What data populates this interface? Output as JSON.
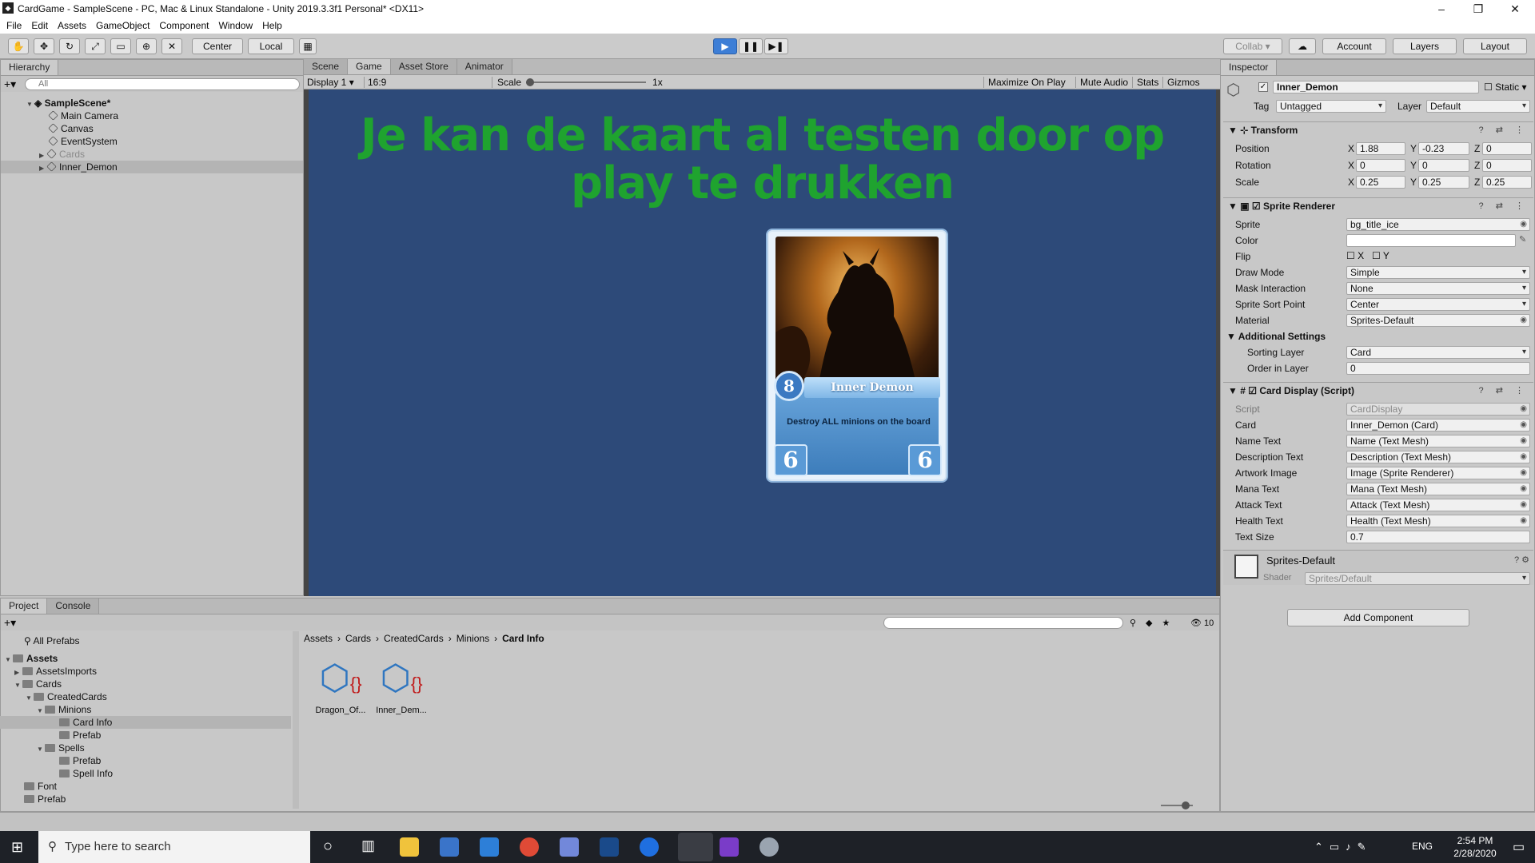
{
  "window": {
    "title": "CardGame - SampleScene - PC, Mac & Linux Standalone - Unity 2019.3.3f1 Personal* <DX11>",
    "min": "–",
    "max": "❐",
    "close": "✕"
  },
  "menu": [
    "File",
    "Edit",
    "Assets",
    "GameObject",
    "Component",
    "Window",
    "Help"
  ],
  "toolbar": {
    "center": "Center",
    "local": "Local",
    "collab": "Collab ▾",
    "account": "Account",
    "layers": "Layers",
    "layout": "Layout"
  },
  "hierarchy": {
    "tab": "Hierarchy",
    "search_placeholder": "All",
    "scene": "SampleScene*",
    "items": [
      "Main Camera",
      "Canvas",
      "EventSystem",
      "Cards",
      "Inner_Demon"
    ]
  },
  "game": {
    "tabs": [
      "Scene",
      "Game",
      "Asset Store",
      "Animator"
    ],
    "display": "Display 1",
    "aspect": "16:9",
    "scale_label": "Scale",
    "scale_value": "1x",
    "maximize": "Maximize On Play",
    "mute": "Mute Audio",
    "stats": "Stats",
    "gizmos": "Gizmos",
    "overlay_text": "Je kan de kaart al testen door op play te drukken",
    "overlay_color": "#1fa32f",
    "bg_color": "#2d4a79"
  },
  "card": {
    "mana": "8",
    "name": "Inner Demon",
    "description": "Destroy ALL minions on the board",
    "attack": "6",
    "health": "6"
  },
  "inspector": {
    "tab": "Inspector",
    "object_name": "Inner_Demon",
    "static": "Static",
    "tag_label": "Tag",
    "tag": "Untagged",
    "layer_label": "Layer",
    "layer": "Default",
    "transform": {
      "title": "Transform",
      "position": {
        "label": "Position",
        "x": "1.88",
        "y": "-0.23",
        "z": "0"
      },
      "rotation": {
        "label": "Rotation",
        "x": "0",
        "y": "0",
        "z": "0"
      },
      "scale": {
        "label": "Scale",
        "x": "0.25",
        "y": "0.25",
        "z": "0.25"
      }
    },
    "sprite_renderer": {
      "title": "Sprite Renderer",
      "sprite_label": "Sprite",
      "sprite": "bg_title_ice",
      "color_label": "Color",
      "flip_label": "Flip",
      "flip_x": "X",
      "flip_y": "Y",
      "draw_mode_label": "Draw Mode",
      "draw_mode": "Simple",
      "mask_label": "Mask Interaction",
      "mask": "None",
      "sort_point_label": "Sprite Sort Point",
      "sort_point": "Center",
      "material_label": "Material",
      "material": "Sprites-Default",
      "additional": "Additional Settings",
      "sorting_layer_label": "Sorting Layer",
      "sorting_layer": "Card",
      "order_label": "Order in Layer",
      "order": "0"
    },
    "card_display": {
      "title": "Card Display (Script)",
      "script_label": "Script",
      "script": "CardDisplay",
      "card_label": "Card",
      "card": "Inner_Demon (Card)",
      "name_text_label": "Name Text",
      "name_text": "Name (Text Mesh)",
      "desc_text_label": "Description Text",
      "desc_text": "Description (Text Mesh)",
      "artwork_label": "Artwork Image",
      "artwork": "Image (Sprite Renderer)",
      "mana_label": "Mana Text",
      "mana": "Mana (Text Mesh)",
      "attack_label": "Attack Text",
      "attack": "Attack (Text Mesh)",
      "health_label": "Health Text",
      "health": "Health (Text Mesh)",
      "text_size_label": "Text Size",
      "text_size": "0.7"
    },
    "material": {
      "name": "Sprites-Default",
      "shader_label": "Shader",
      "shader": "Sprites/Default"
    },
    "add_component": "Add Component"
  },
  "project": {
    "tabs": [
      "Project",
      "Console"
    ],
    "count": "10",
    "favorites": [
      "All Prefabs"
    ],
    "tree": [
      "Assets",
      "AssetsImports",
      "Cards",
      "CreatedCards",
      "Minions",
      "Card Info",
      "Prefab",
      "Spells",
      "Prefab",
      "Spell Info",
      "Font",
      "Prefab"
    ],
    "breadcrumb": [
      "Assets",
      "Cards",
      "CreatedCards",
      "Minions",
      "Card Info"
    ],
    "files": [
      "Dragon_Of...",
      "Inner_Dem..."
    ]
  },
  "taskbar": {
    "search": "Type here to search",
    "lang": "ENG",
    "time": "2:54 PM",
    "date": "2/28/2020"
  }
}
